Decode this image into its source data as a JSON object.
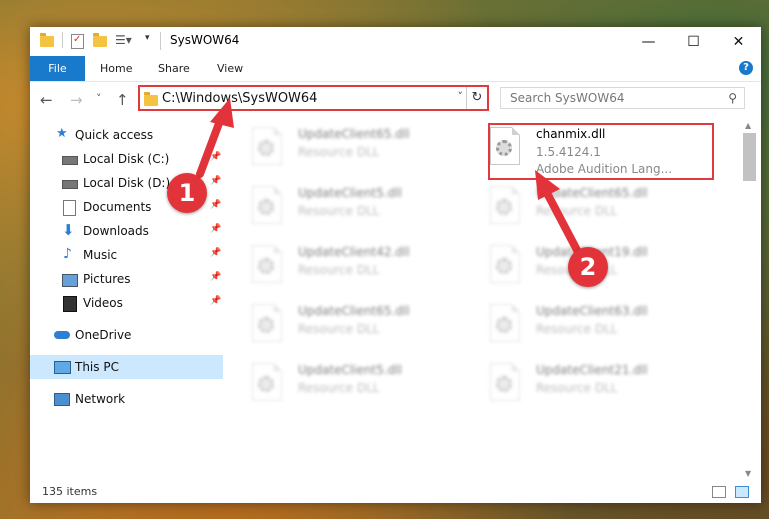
{
  "window": {
    "title": "SysWOW64",
    "minimize": "—",
    "maximize": "☐",
    "close": "✕"
  },
  "ribbon": {
    "file": "File",
    "home": "Home",
    "share": "Share",
    "view": "View",
    "help": "?"
  },
  "nav": {
    "back": "←",
    "forward": "→",
    "recent": "˅",
    "up": "↑",
    "address": "C:\\Windows\\SysWOW64",
    "address_dropdown": "˅",
    "refresh": "↻",
    "search_placeholder": "Search SysWOW64",
    "search_icon": "⚲"
  },
  "sidebar": [
    {
      "label": "Quick access",
      "icon": "star-icon",
      "pinned": false
    },
    {
      "label": "Local Disk (C:)",
      "icon": "drive-icon",
      "pinned": true
    },
    {
      "label": "Local Disk (D:)",
      "icon": "drive-icon",
      "pinned": true
    },
    {
      "label": "Documents",
      "icon": "documents-icon",
      "pinned": true
    },
    {
      "label": "Downloads",
      "icon": "downloads-icon",
      "pinned": true
    },
    {
      "label": "Music",
      "icon": "music-icon",
      "pinned": true
    },
    {
      "label": "Pictures",
      "icon": "pictures-icon",
      "pinned": true
    },
    {
      "label": "Videos",
      "icon": "videos-icon",
      "pinned": true
    },
    {
      "label": "OneDrive",
      "icon": "onedrive-icon",
      "pinned": false
    },
    {
      "label": "This PC",
      "icon": "this-pc-icon",
      "pinned": false,
      "selected": true
    },
    {
      "label": "Network",
      "icon": "network-icon",
      "pinned": false
    }
  ],
  "pin_glyph": "📌",
  "files_left": [
    {
      "name": "UpdateClient65.dll",
      "type": "Resource DLL"
    },
    {
      "name": "UpdateClient5.dll",
      "type": "Resource DLL"
    },
    {
      "name": "UpdateClient42.dll",
      "type": "Resource DLL"
    },
    {
      "name": "UpdateClient65.dll",
      "type": "Resource DLL"
    },
    {
      "name": "UpdateClient5.dll",
      "type": "Resource DLL"
    }
  ],
  "files_right": [
    {
      "name": "UpdateClient65.dll",
      "type": "Resource DLL"
    },
    {
      "name": "UpdateClient19.dll",
      "type": "Resource DLL"
    },
    {
      "name": "UpdateClient63.dll",
      "type": "Resource DLL"
    },
    {
      "name": "UpdateClient21.dll",
      "type": "Resource DLL"
    }
  ],
  "selected_file": {
    "name": "chanmix.dll",
    "version": "1.5.4124.1",
    "description": "Adobe Audition Lang..."
  },
  "status": {
    "items": "135 items"
  },
  "annotations": {
    "step1": "1",
    "step2": "2",
    "color": "#e2333a"
  }
}
